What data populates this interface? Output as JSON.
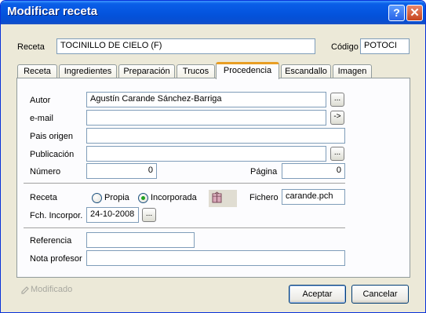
{
  "window": {
    "title": "Modificar receta",
    "help_symbol": "?",
    "close_symbol": "✕"
  },
  "header": {
    "receta_label": "Receta",
    "receta_value": "TOCINILLO DE CIELO (F)",
    "codigo_label": "Código",
    "codigo_value": "POTOCI"
  },
  "tabs": [
    {
      "label": "Receta"
    },
    {
      "label": "Ingredientes"
    },
    {
      "label": "Preparación"
    },
    {
      "label": "Trucos"
    },
    {
      "label": "Procedencia"
    },
    {
      "label": "Escandallo"
    },
    {
      "label": "Imagen"
    }
  ],
  "active_tab": "Procedencia",
  "form": {
    "autor_label": "Autor",
    "autor_value": "Agustín Carande Sánchez-Barriga",
    "email_label": "e-mail",
    "email_value": "",
    "pais_label": "Pais origen",
    "pais_value": "",
    "publicacion_label": "Publicación",
    "publicacion_value": "",
    "numero_label": "Número",
    "numero_value": "0",
    "pagina_label": "Página",
    "pagina_value": "0",
    "receta_label": "Receta",
    "radio_propia": "Propia",
    "radio_incorporada": "Incorporada",
    "selected_option": "Incorporada",
    "fichero_label": "Fichero",
    "fichero_value": "carande.pch",
    "fch_label": "Fch. Incorpor.",
    "fch_value": "24-10-2008",
    "referencia_label": "Referencia",
    "referencia_value": "",
    "nota_label": "Nota profesor",
    "nota_value": "",
    "browse_symbol": "...",
    "email_go_symbol": "->"
  },
  "footer": {
    "modificado_label": "Modificado",
    "aceptar_label": "Aceptar",
    "cancelar_label": "Cancelar"
  },
  "colors": {
    "titlebar": "#0556e0",
    "window_bg": "#ece9d8",
    "active_tab_accent": "#e89e25"
  }
}
